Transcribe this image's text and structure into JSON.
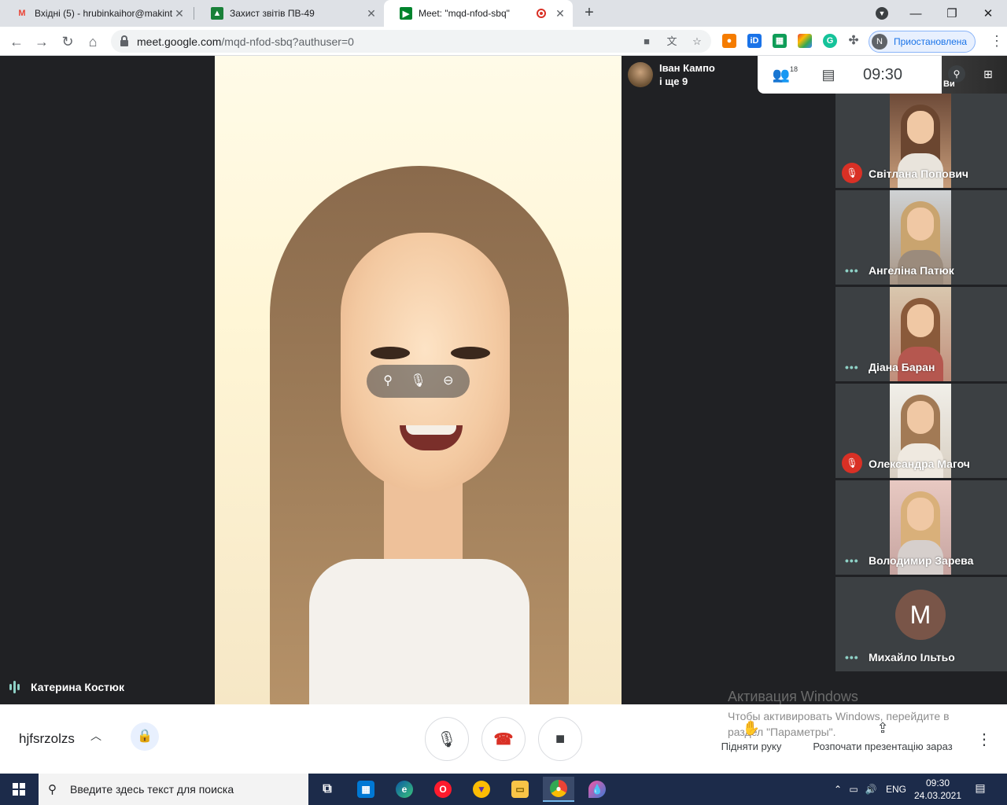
{
  "browser": {
    "tabs": [
      {
        "label": "Вхідні (5) - hrubinkaihor@makint",
        "icon": "gmail-icon",
        "color": "#ea4335"
      },
      {
        "label": "Захист звітів ПВ-49",
        "icon": "classroom-icon",
        "color": "#188038"
      },
      {
        "label": "Meet: \"mqd-nfod-sbq\"",
        "icon": "meet-icon",
        "color": "#00832d"
      }
    ],
    "new_tab": "+",
    "url_domain": "meet.google.com",
    "url_path": "/mqd-nfod-sbq?authuser=0",
    "profile_initial": "N",
    "profile_label": "Приостановлена"
  },
  "meet": {
    "main_speaker": "Катерина Костюк",
    "presenter": {
      "line1": "Іван Кампо",
      "line2": "і ще 9"
    },
    "participants_count": "18",
    "clock": "09:30",
    "top_right_label": "Ви",
    "participants": [
      {
        "name": "Світлана Попович",
        "status": "muted"
      },
      {
        "name": "Ангеліна Патюк",
        "status": "dots"
      },
      {
        "name": "Діана Баран",
        "status": "dots"
      },
      {
        "name": "Олександра Магоч",
        "status": "muted"
      },
      {
        "name": "Володимир Зарева",
        "status": "dots"
      },
      {
        "name": "Михайло Ільтьо",
        "status": "dots",
        "avatar_letter": "M"
      }
    ],
    "meeting_code": "hjfsrzolzs",
    "raise_hand": "Підняти руку",
    "present_now": "Розпочати презентацію зараз"
  },
  "windows_activation": {
    "title": "Активация Windows",
    "body": "Чтобы активировать Windows, перейдите в раздел \"Параметры\"."
  },
  "taskbar": {
    "search_placeholder": "Введите здесь текст для поиска",
    "language": "ENG",
    "time": "09:30",
    "date": "24.03.2021"
  }
}
